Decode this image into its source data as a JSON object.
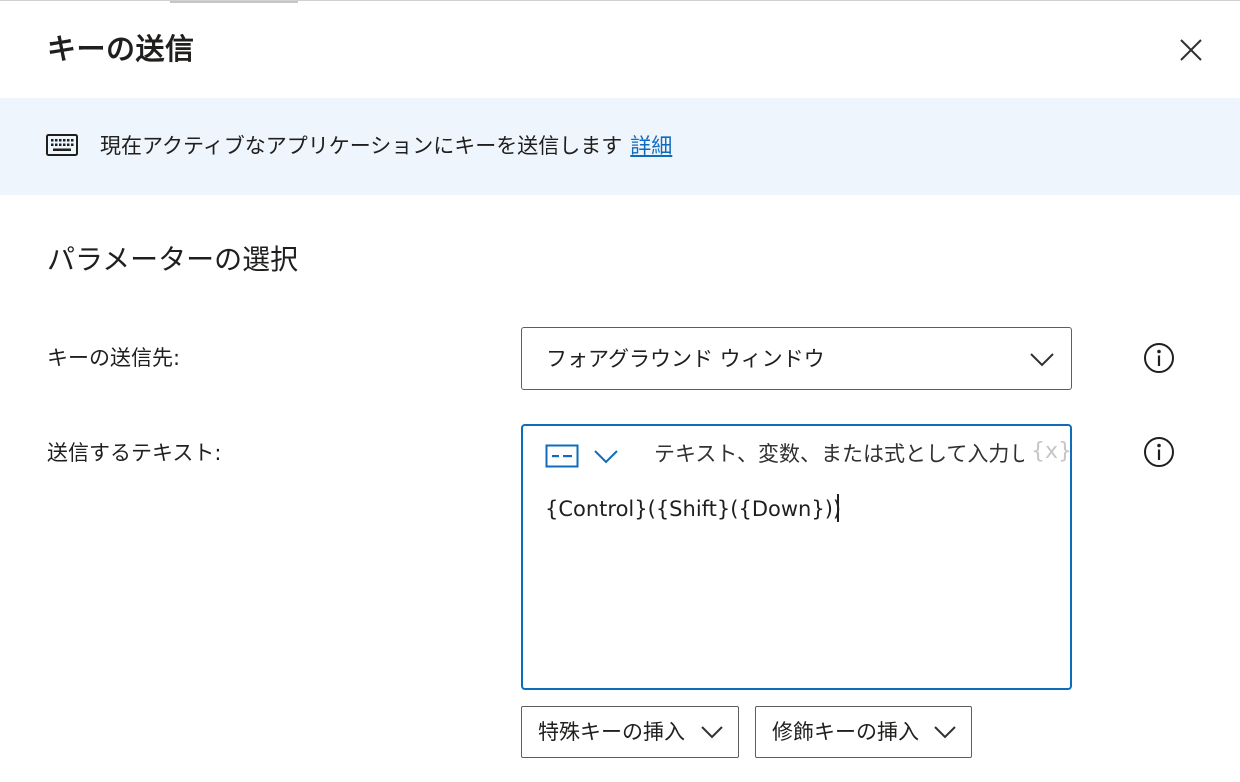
{
  "dialog": {
    "title": "キーの送信",
    "close_icon": "close-icon"
  },
  "banner": {
    "icon": "keyboard-icon",
    "description": "現在アクティブなアプリケーションにキーを送信します",
    "link_label": "詳細",
    "background_color": "#eff5fd",
    "link_color": "#0f6cbd"
  },
  "parameters": {
    "section_title": "パラメーターの選択",
    "send_to": {
      "label": "キーの送信先:",
      "value": "フォアグラウンド ウィンドウ",
      "icon": "chevron-down-icon",
      "info_icon": "info-icon"
    },
    "text_to_send": {
      "label": "送信するテキスト:",
      "placeholder": "テキスト、変数、または式として入力します",
      "variable_button": "{x}",
      "value": "{Control}({Shift}({Down}))",
      "mode_icon": "text-mode-icon",
      "info_icon": "info-icon",
      "focus_color": "#0f6cbd"
    },
    "buttons": {
      "special_keys": "特殊キーの挿入",
      "modifier_keys": "修飾キーの挿入"
    }
  }
}
